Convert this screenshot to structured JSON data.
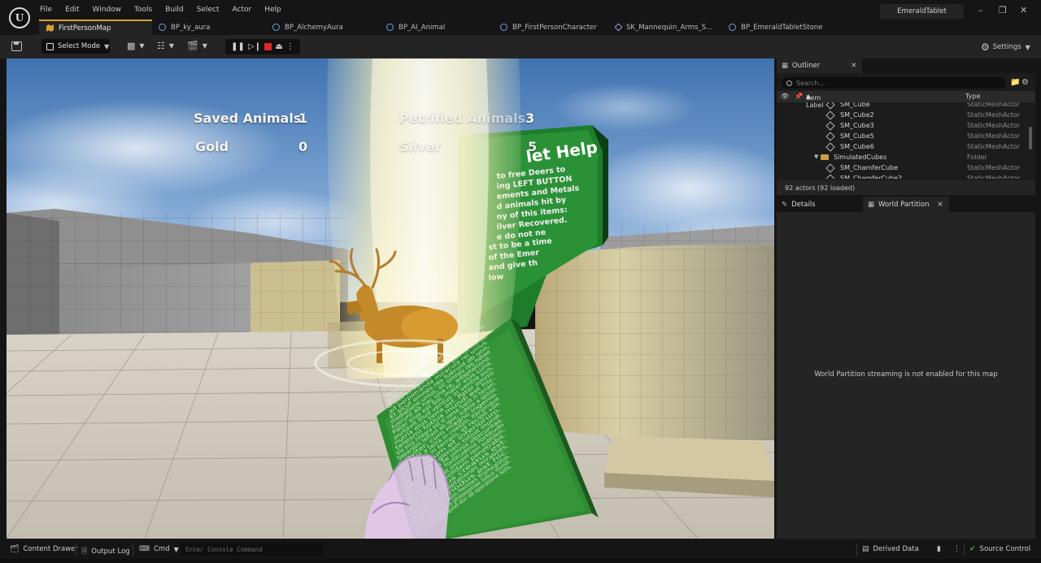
{
  "menubar": {
    "items": [
      "File",
      "Edit",
      "Window",
      "Tools",
      "Build",
      "Select",
      "Actor",
      "Help"
    ],
    "project_name": "EmeraldTablet"
  },
  "tabs": [
    {
      "label": "FirstPersonMap",
      "icon": "map-icon",
      "active": true
    },
    {
      "label": "BP_ky_aura",
      "icon": "blueprint-icon"
    },
    {
      "label": "BP_AlchemyAura",
      "icon": "blueprint-icon"
    },
    {
      "label": "BP_AI_Animal",
      "icon": "blueprint-icon"
    },
    {
      "label": "BP_FirstPersonCharacter",
      "icon": "blueprint-icon"
    },
    {
      "label": "SK_Mannequin_Arms_S...",
      "icon": "skeleton-icon"
    },
    {
      "label": "BP_EmeraldTabletStone",
      "icon": "blueprint-icon"
    }
  ],
  "toolbar": {
    "select_mode": "Select Mode",
    "settings": "Settings"
  },
  "hud": {
    "saved_animals_label": "Saved Animals",
    "saved_animals_value": "1",
    "petrified_label": "Petrified Animals",
    "petrified_value": "3",
    "gold_label": "Gold",
    "gold_value": "0",
    "silver_label": "Silver",
    "silver_value": "5"
  },
  "scene": {
    "help_sign_title": "let Help",
    "help_sign_lines": [
      "to free Deers to",
      "ing LEFT BUTTON",
      "ements and Metals",
      "d animals hit by",
      "ny of this items:",
      "ilver Recovered.",
      "e do not ne",
      "st to be a time",
      "of the Emer",
      "and give th",
      "low"
    ],
    "tablet_lines": [
      "Verum sine mendacio, certum et verissimum:",
      "quod est inferius est sicut quod est superius,",
      "et quod est superius est sicut quod est inferius,",
      "ad perpetranda miracula rei unius.",
      "Et sicut omnes res fuerunt ab uno,",
      "mediatione unius, sic omnes res natae",
      "fuerunt ab hac una re, adaptatione.",
      "Pater eius est Sol, mater eius Luna,",
      "portavit illud ventus in ventre suo,",
      "nutrix eius terra est. Pater omnis",
      "telesmi totius mundi est hic.",
      "Vis eius integra est si versa fuerit in terram.",
      "Separabis terram ab igne, subtile a spisso,",
      "suaviter, cum magno ingenio.",
      "Ascendit a terra in coelum, iterumque",
      "descendit in terram, et recipit vim",
      "superiorum et inferiorum.",
      "Sic habebis gloriam totius mundi.",
      "Ideo fugiet a te omnis obscuritas.",
      "Hic est totius fortitudinis fortitudo",
      "fortis: quia vincet omnem rem subtilem,",
      "omnemque solidam penetrabit.",
      "Sic mundus creatus est.",
      "Hinc erunt adaptationes mirabiles,",
      "quarum modus est hic.",
      "Itaque vocatus sum Hermes Trismegistus,",
      "habens tres partes philosophiae totius mundi.",
      "Completum est quod dixi de operatione Solis."
    ]
  },
  "outliner": {
    "title": "Outliner",
    "search_placeholder": "Search...",
    "col_label": "Item Label",
    "col_type": "Type",
    "rows": [
      {
        "name": "SM_Cube",
        "type": "StaticMeshActor",
        "kind": "mesh",
        "indent": 62
      },
      {
        "name": "SM_Cube2",
        "type": "StaticMeshActor",
        "kind": "mesh",
        "indent": 62
      },
      {
        "name": "SM_Cube3",
        "type": "StaticMeshActor",
        "kind": "mesh",
        "indent": 62
      },
      {
        "name": "SM_Cube5",
        "type": "StaticMeshActor",
        "kind": "mesh",
        "indent": 62
      },
      {
        "name": "SM_Cube6",
        "type": "StaticMeshActor",
        "kind": "mesh",
        "indent": 62
      },
      {
        "name": "SimulatedCubes",
        "type": "Folder",
        "kind": "folder",
        "indent": 54
      },
      {
        "name": "SM_ChamferCube",
        "type": "StaticMeshActor",
        "kind": "mesh",
        "indent": 62
      },
      {
        "name": "SM_ChamferCube2",
        "type": "StaticMeshActor",
        "kind": "mesh",
        "indent": 62
      }
    ],
    "actor_count": "92 actors (92 loaded)"
  },
  "details": {
    "tab_details": "Details",
    "tab_world_partition": "World Partition",
    "message": "World Partition streaming is not enabled for this map"
  },
  "statusbar": {
    "content_drawer": "Content Drawer",
    "output_log": "Output Log",
    "cmd": "Cmd",
    "console_placeholder": "Enter Console Command",
    "derived_data": "Derived Data",
    "source_control": "Source Control"
  },
  "colors": {
    "accent": "#d8a030",
    "sky": "#5a8cc4",
    "floor": "#cfc8ba",
    "tablet_green": "#2e8b32",
    "stop_red": "#e02828",
    "source_control_green": "#4cae4f"
  }
}
